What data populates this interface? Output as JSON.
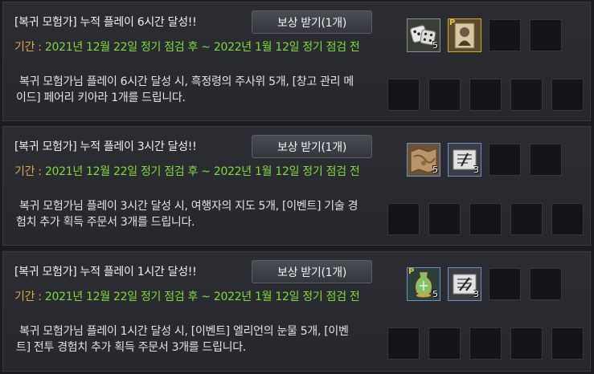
{
  "rewards": [
    {
      "title": "[복귀 모험가] 누적 플레이 6시간 달성!!",
      "button": "보상 받기(1개)",
      "period_label": "기간 :",
      "period_value": "2021년 12월 22일 정기 점검 후 ~ 2022년 1월 12일 정기 점검 전",
      "description": "복귀 모험가님 플레이 6시간 달성 시, 흑정령의 주사위 5개, [창고 관리 메이드] 페어리 키아라 1개를 드립니다.",
      "items": [
        {
          "icon": "dice-icon",
          "count": "5"
        },
        {
          "icon": "maid-scroll-icon",
          "count": ""
        }
      ]
    },
    {
      "title": "[복귀 모험가] 누적 플레이 3시간 달성!!",
      "button": "보상 받기(1개)",
      "period_label": "기간 :",
      "period_value": "2021년 12월 22일 정기 점검 후 ~ 2022년 1월 12일 정기 점검 전",
      "description": "복귀 모험가님 플레이 3시간 달성 시, 여행자의 지도 5개, [이벤트] 기술 경험치 추가 획득 주문서 3개를 드립니다.",
      "items": [
        {
          "icon": "traveler-map-icon",
          "count": "5"
        },
        {
          "icon": "skill-exp-scroll-icon",
          "count": "3"
        }
      ]
    },
    {
      "title": "[복귀 모험가] 누적 플레이 1시간 달성!!",
      "button": "보상 받기(1개)",
      "period_label": "기간 :",
      "period_value": "2021년 12월 22일 정기 점검 후 ~ 2022년 1월 12일 정기 점검 전",
      "description": "복귀 모험가님 플레이 1시간 달성 시, [이벤트] 엘리언의 눈물 5개, [이벤트] 전투 경험치 추가 획득 주문서 3개를 드립니다.",
      "items": [
        {
          "icon": "elion-tears-icon",
          "count": "5"
        },
        {
          "icon": "combat-exp-scroll-icon",
          "count": "3"
        }
      ]
    }
  ],
  "badge_letter": "P",
  "colors": {
    "period_label": "#e0a64a",
    "period_value": "#7fdc3a",
    "gold_border": "#d8a62a",
    "blue_border": "#6b8fcc"
  }
}
